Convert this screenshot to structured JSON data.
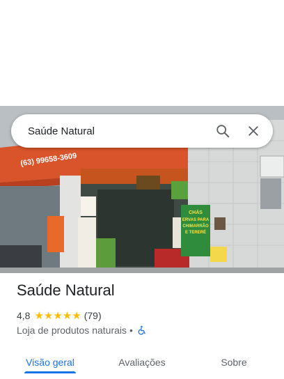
{
  "search": {
    "query": "Saúde Natural"
  },
  "place": {
    "name": "Saúde Natural",
    "rating": "4,8",
    "stars": "★★★★★",
    "review_count": "(79)",
    "category": "Loja de produtos naturais",
    "separator": "•"
  },
  "photo_signs": {
    "phone": "(63) 99658-3609",
    "cha_sign": [
      "CHÁS",
      "ERVAS PARA",
      "CHIMARRÃO",
      "E TERERÉ"
    ]
  },
  "tabs": [
    {
      "label": "Visão geral",
      "active": true
    },
    {
      "label": "Avaliações",
      "active": false
    },
    {
      "label": "Sobre",
      "active": false
    }
  ],
  "colors": {
    "accent": "#1a73e8",
    "star": "#fbbc04",
    "storefront_orange": "#d9542b"
  },
  "icons": [
    "search-icon",
    "close-icon",
    "wheelchair-icon"
  ]
}
